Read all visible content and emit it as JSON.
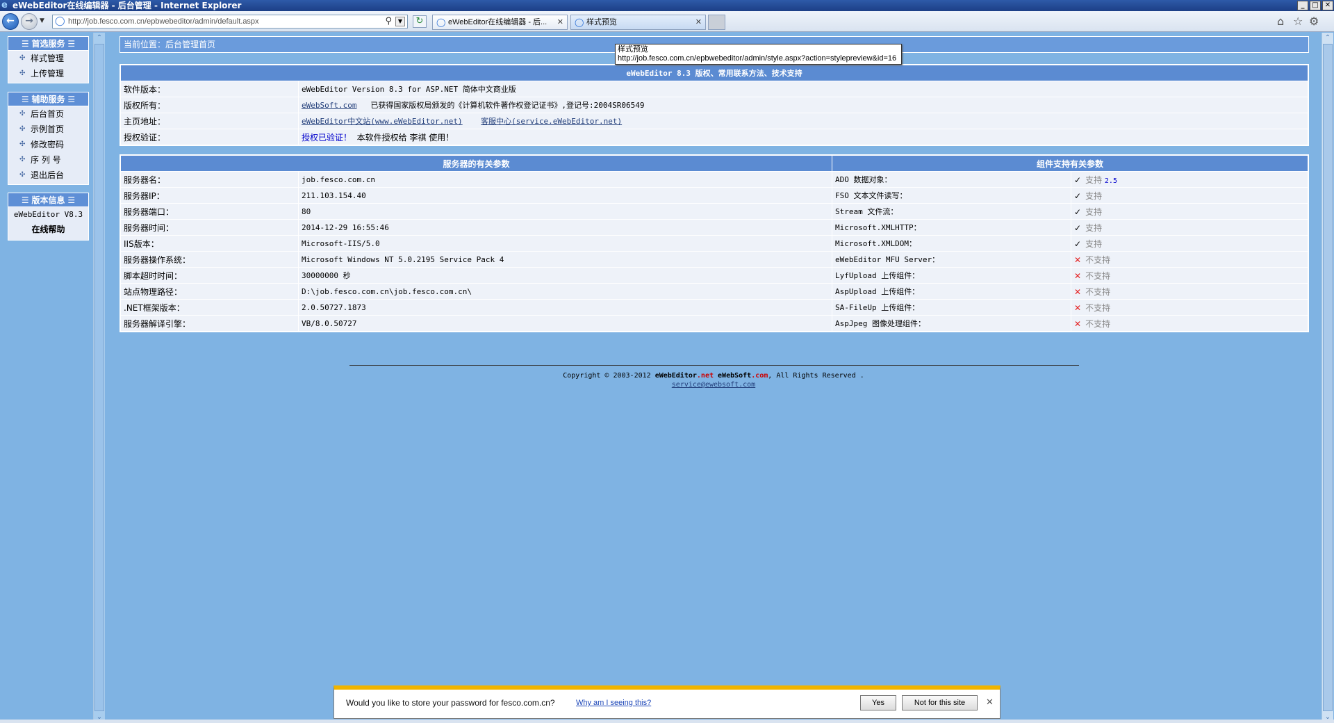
{
  "window": {
    "title": "eWebEditor在线编辑器 - 后台管理 - Internet Explorer",
    "controls": [
      "_",
      "□",
      "✕"
    ]
  },
  "browser": {
    "url": "http://job.fesco.com.cn/epbwebeditor/admin/default.aspx",
    "tabs": [
      {
        "label": "eWebEditor在线编辑器 - 后...",
        "active": false
      },
      {
        "label": "样式预览",
        "active": true
      }
    ],
    "icons": [
      "back-arrow-icon",
      "forward-arrow-icon",
      "search-icon",
      "refresh-icon",
      "home-icon",
      "star-icon",
      "gear-icon"
    ]
  },
  "tooltip": {
    "title": "样式预览",
    "url": "http://job.fesco.com.cn/epbwebeditor/admin/style.aspx?action=stylepreview&id=16"
  },
  "sidebar": {
    "panels": [
      {
        "title": "首选服务",
        "items": [
          "样式管理",
          "上传管理"
        ]
      },
      {
        "title": "辅助服务",
        "items": [
          "后台首页",
          "示例首页",
          "修改密码",
          "序 列 号",
          "退出后台"
        ]
      },
      {
        "title": "版本信息",
        "version": "eWebEditor V8.3",
        "help": "在线帮助"
      }
    ]
  },
  "main": {
    "breadcrumb": "当前位置：后台管理首页",
    "info_header": "eWebEditor 8.3 版权、常用联系方法、技术支持",
    "info_rows": {
      "version_label": "软件版本：",
      "version_value": "eWebEditor Version 8.3 for ASP.NET 简体中文商业版",
      "copyright_label": "版权所有：",
      "copyright_link": "eWebSoft.com",
      "copyright_text": "已获得国家版权局颁发的《计算机软件著作权登记证书》,登记号:2004SR06549",
      "home_label": "主页地址：",
      "home_link1": "eWebEditor中文站(www.eWebEditor.net)",
      "home_link2": "客服中心(service.eWebEditor.net)",
      "auth_label": "授权验证：",
      "auth_status": "授权已验证！",
      "auth_text": "本软件授权给 李祺 使用！"
    },
    "server_header": "服务器的有关参数",
    "component_header": "组件支持有关参数",
    "server_rows": [
      {
        "label": "服务器名：",
        "value": "job.fesco.com.cn"
      },
      {
        "label": "服务器IP：",
        "value": "211.103.154.40"
      },
      {
        "label": "服务器端口：",
        "value": "80"
      },
      {
        "label": "服务器时间：",
        "value": "2014-12-29 16:55:46"
      },
      {
        "label": "IIS版本：",
        "value": "Microsoft-IIS/5.0"
      },
      {
        "label": "服务器操作系统：",
        "value": "Microsoft Windows NT 5.0.2195 Service Pack 4"
      },
      {
        "label": "脚本超时时间：",
        "value": "30000000 秒"
      },
      {
        "label": "站点物理路径：",
        "value": "D:\\job.fesco.com.cn\\job.fesco.com.cn\\"
      },
      {
        "label": ".NET框架版本：",
        "value": "2.0.50727.1873"
      },
      {
        "label": "服务器解译引擎：",
        "value": "VB/8.0.50727"
      }
    ],
    "component_rows": [
      {
        "label": "ADO 数据对象：",
        "status": "支持",
        "extra": "2.5",
        "ok": true
      },
      {
        "label": "FSO 文本文件读写：",
        "status": "支持",
        "extra": "",
        "ok": true
      },
      {
        "label": "Stream 文件流：",
        "status": "支持",
        "extra": "",
        "ok": true
      },
      {
        "label": "Microsoft.XMLHTTP：",
        "status": "支持",
        "extra": "",
        "ok": true
      },
      {
        "label": "Microsoft.XMLDOM：",
        "status": "支持",
        "extra": "",
        "ok": true
      },
      {
        "label": "eWebEditor MFU Server：",
        "status": "不支持",
        "extra": "",
        "ok": false
      },
      {
        "label": "LyfUpload 上传组件：",
        "status": "不支持",
        "extra": "",
        "ok": false
      },
      {
        "label": "AspUpload 上传组件：",
        "status": "不支持",
        "extra": "",
        "ok": false
      },
      {
        "label": "SA-FileUp 上传组件：",
        "status": "不支持",
        "extra": "",
        "ok": false
      },
      {
        "label": "AspJpeg 图像处理组件：",
        "status": "不支持",
        "extra": "",
        "ok": false
      }
    ],
    "footer": {
      "copyright_prefix": "Copyright © 2003-2012",
      "brand1_a": "eWebEditor",
      "brand1_b": ".net",
      "brand2_a": "eWebSoft",
      "brand2_b": ".com",
      "copyright_suffix": ", All Rights Reserved .",
      "email": "service@ewebsoft.com"
    }
  },
  "password_bar": {
    "question": "Would you like to store your password for fesco.com.cn?",
    "why": "Why am I seeing this?",
    "yes": "Yes",
    "no": "Not for this site",
    "close": "✕"
  },
  "colors": {
    "page_bg": "#7fb3e3",
    "header_bg": "#5b8bd2",
    "ok_check": "#000000",
    "no_x": "#e41e1e",
    "bar_accent": "#f0b400"
  }
}
